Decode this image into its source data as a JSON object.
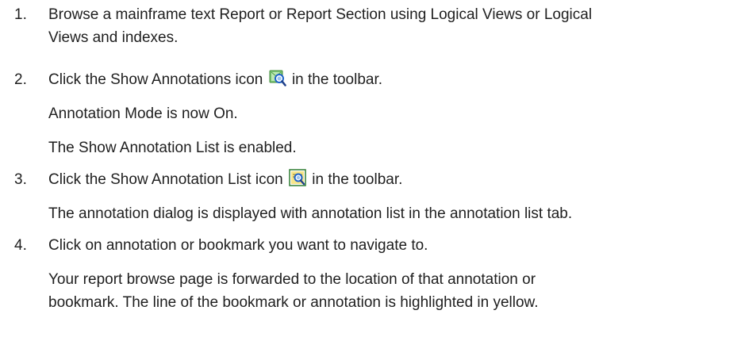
{
  "steps": [
    {
      "number": "1.",
      "lines": [
        "Browse a mainframe text Report or Report Section using Logical Views or Logical",
        "Views and indexes."
      ]
    },
    {
      "number": "2.",
      "before_icon": "Click the Show Annotations icon",
      "icon": "show-annotations-icon",
      "after_icon": "in the toolbar.",
      "notes": [
        "Annotation Mode is now On.",
        "The Show Annotation List is enabled."
      ]
    },
    {
      "number": "3.",
      "before_icon": "Click the Show Annotation List icon",
      "icon": "show-annotation-list-icon",
      "after_icon": "in the toolbar.",
      "notes": [
        "The annotation dialog is displayed with annotation list in the annotation list tab."
      ]
    },
    {
      "number": "4.",
      "text": "Click on annotation or bookmark you want to navigate to.",
      "notes": [
        "Your report browse page is forwarded to the location of that annotation or",
        "bookmark. The line of the bookmark or annotation is highlighted in yellow."
      ]
    }
  ]
}
